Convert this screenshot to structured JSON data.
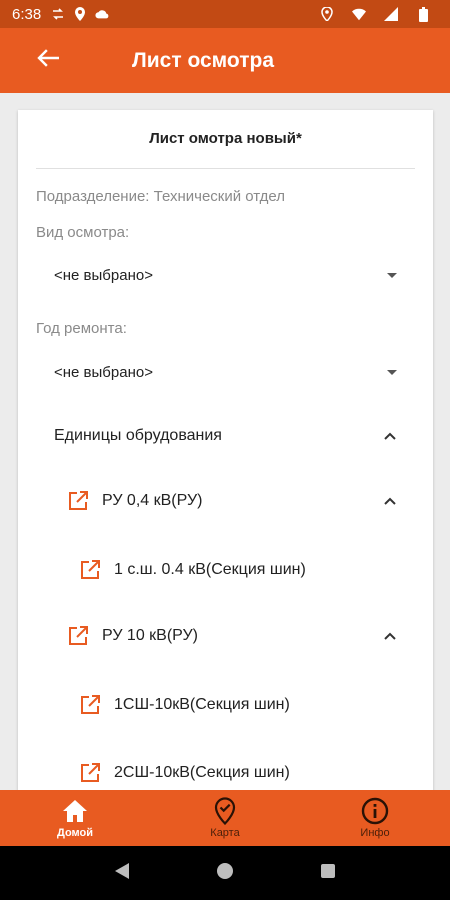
{
  "status_bar": {
    "time": "6:38",
    "icons": [
      "sync-icon",
      "location-icon",
      "cloud-icon",
      "location-icon",
      "wifi-icon",
      "signal-icon",
      "battery-icon"
    ]
  },
  "app_bar": {
    "back_icon": "arrow-left-icon",
    "title": "Лист осмотра"
  },
  "card": {
    "title": "Лист омотра  новый*",
    "division_label": "Подразделение: Технический отдел",
    "inspection_type_label": "Вид осмотра:",
    "inspection_type_value": "<не выбрано>",
    "repair_year_label": "Год ремонта:",
    "repair_year_value": "<не выбрано>",
    "equipment_header": "Единицы обрудования",
    "groups": [
      {
        "label": "РУ 0,4 кВ(РУ)",
        "items": [
          "1 с.ш. 0.4 кВ(Секция шин)"
        ]
      },
      {
        "label": "РУ 10 кВ(РУ)",
        "items": [
          "1СШ-10кВ(Секция шин)",
          "2СШ-10кВ(Секция шин)"
        ]
      }
    ]
  },
  "bottom_nav": [
    {
      "label": "Домой",
      "icon": "home-icon",
      "active": true
    },
    {
      "label": "Карта",
      "icon": "map-pin-icon",
      "active": false
    },
    {
      "label": "Инфо",
      "icon": "info-icon",
      "active": false
    }
  ],
  "colors": {
    "primary": "#e85b21",
    "status_bar": "#c24a14",
    "background": "#ececec"
  }
}
